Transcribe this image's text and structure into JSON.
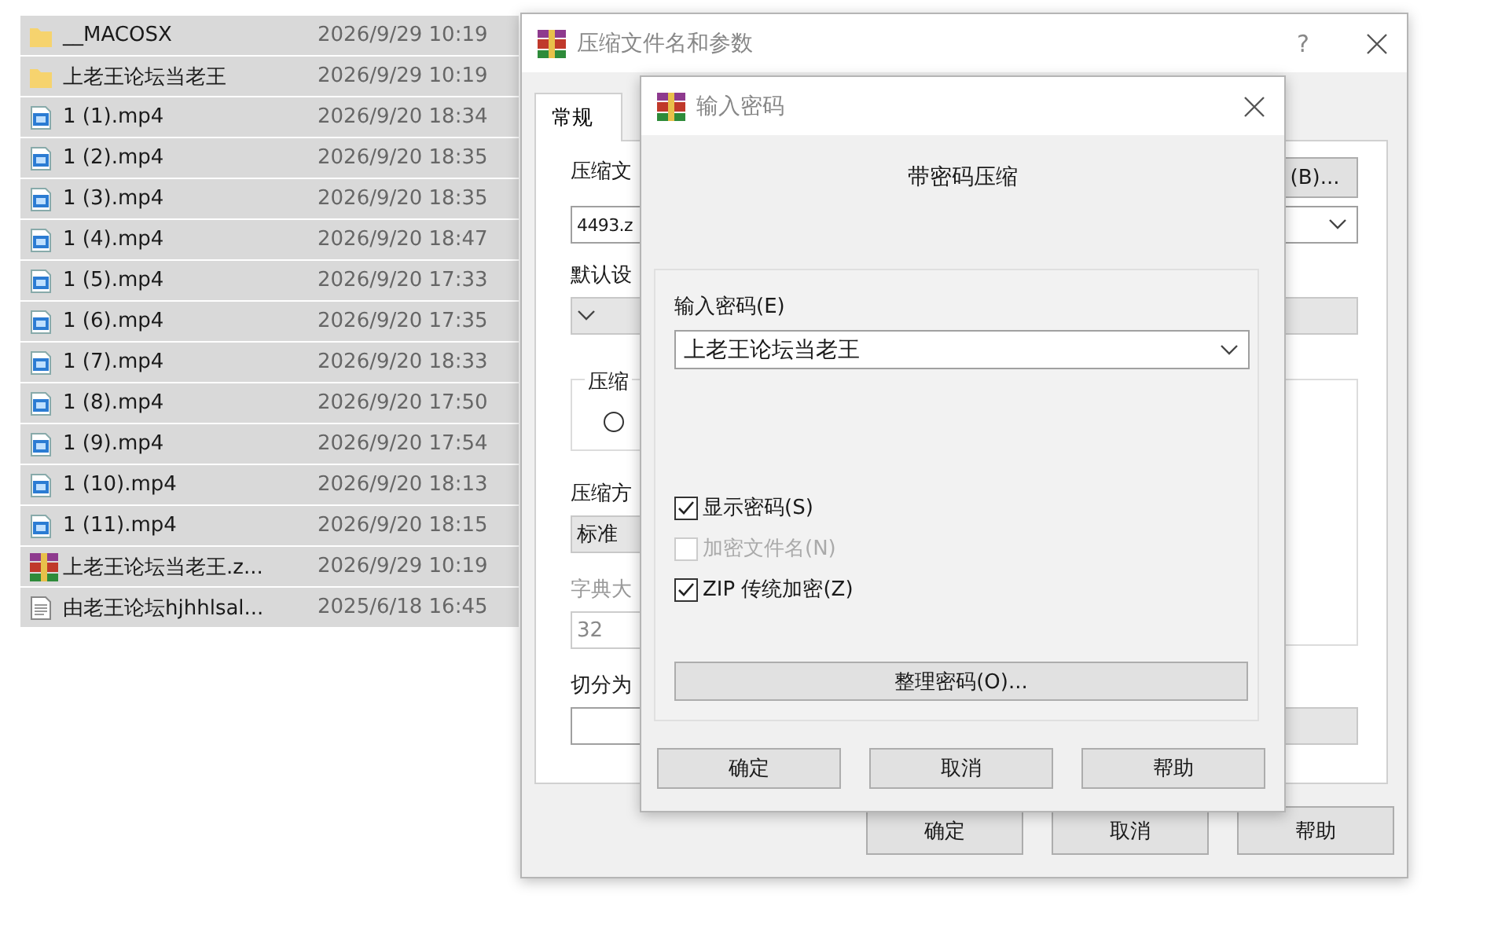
{
  "files": [
    {
      "kind": "folder",
      "name": "__MACOSX",
      "date": "2026/9/29 10:19",
      "selected": true
    },
    {
      "kind": "folder",
      "name": "上老王论坛当老王",
      "date": "2026/9/29 10:19",
      "selected": true
    },
    {
      "kind": "video",
      "name": "1 (1).mp4",
      "date": "2026/9/20 18:34",
      "selected": true
    },
    {
      "kind": "video",
      "name": "1 (2).mp4",
      "date": "2026/9/20 18:35",
      "selected": true
    },
    {
      "kind": "video",
      "name": "1 (3).mp4",
      "date": "2026/9/20 18:35",
      "selected": true
    },
    {
      "kind": "video",
      "name": "1 (4).mp4",
      "date": "2026/9/20 18:47",
      "selected": true
    },
    {
      "kind": "video",
      "name": "1 (5).mp4",
      "date": "2026/9/20 17:33",
      "selected": true
    },
    {
      "kind": "video",
      "name": "1 (6).mp4",
      "date": "2026/9/20 17:35",
      "selected": true
    },
    {
      "kind": "video",
      "name": "1 (7).mp4",
      "date": "2026/9/20 18:33",
      "selected": true
    },
    {
      "kind": "video",
      "name": "1 (8).mp4",
      "date": "2026/9/20 17:50",
      "selected": true
    },
    {
      "kind": "video",
      "name": "1 (9).mp4",
      "date": "2026/9/20 17:54",
      "selected": true
    },
    {
      "kind": "video",
      "name": "1 (10).mp4",
      "date": "2026/9/20 18:13",
      "selected": true
    },
    {
      "kind": "video",
      "name": "1 (11).mp4",
      "date": "2026/9/20 18:15",
      "selected": true
    },
    {
      "kind": "archive",
      "name": "上老王论坛当老王.z...",
      "date": "2026/9/29 10:19",
      "selected": true
    },
    {
      "kind": "text",
      "name": "由老王论坛hjhhlsal...",
      "date": "2025/6/18 16:45",
      "selected": true
    }
  ],
  "archive_dialog": {
    "title": "压缩文件名和参数",
    "help": "?",
    "tabs": [
      {
        "label": "常规",
        "selected": true
      }
    ],
    "browse_button": "(B)...",
    "archive_name_label": "压缩文",
    "archive_name_value": "4493.z",
    "profile_label": "默认设",
    "format_group_label": "压缩",
    "format_radio": {
      "selected": false
    },
    "method_label": "压缩方",
    "method_value": "标准",
    "dictionary_label": "字典大",
    "dictionary_value": "32",
    "dictionary_disabled": true,
    "split_label": "切分为",
    "buttons": [
      "确定",
      "取消",
      "帮助"
    ]
  },
  "password_dialog": {
    "title": "输入密码",
    "heading": "带密码压缩",
    "password_label": "输入密码(E)",
    "password_value": "上老王论坛当老王",
    "options": [
      {
        "label": "显示密码(S)",
        "checked": true,
        "disabled": false
      },
      {
        "label": "加密文件名(N)",
        "checked": false,
        "disabled": true
      },
      {
        "label": "ZIP 传统加密(Z)",
        "checked": true,
        "disabled": false
      }
    ],
    "organize_button": "整理密码(O)...",
    "buttons": [
      "确定",
      "取消",
      "帮助"
    ]
  }
}
